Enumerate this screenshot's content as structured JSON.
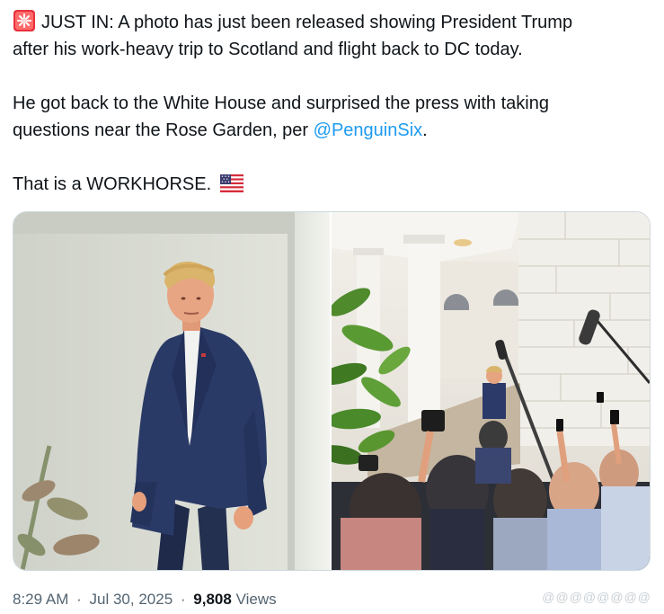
{
  "tweet": {
    "line1_lead": "JUST IN: A photo has just been released showing President Trump",
    "line1_cont": "after his work-heavy trip to Scotland and flight back to DC today.",
    "line2_a": "He got back to the White House and surprised the press with taking",
    "line2_b": "questions near the Rose Garden, per ",
    "mention": "@PenguinSix",
    "line2_end": ".",
    "line3": "That is a WORKHORSE.",
    "siren_icon": "police-light-emoji",
    "flag_icon": "us-flag-emoji",
    "mention_color": "#1d9bf0"
  },
  "media": {
    "photo1_name": "trump-portrait-colonnade",
    "photo2_name": "press-gaggle-rose-garden"
  },
  "meta": {
    "time": "8:29 AM",
    "separator": "·",
    "date": "Jul 30, 2025",
    "views_count": "9,808",
    "views_label": "Views"
  },
  "watermark": "@@@@@@@@"
}
